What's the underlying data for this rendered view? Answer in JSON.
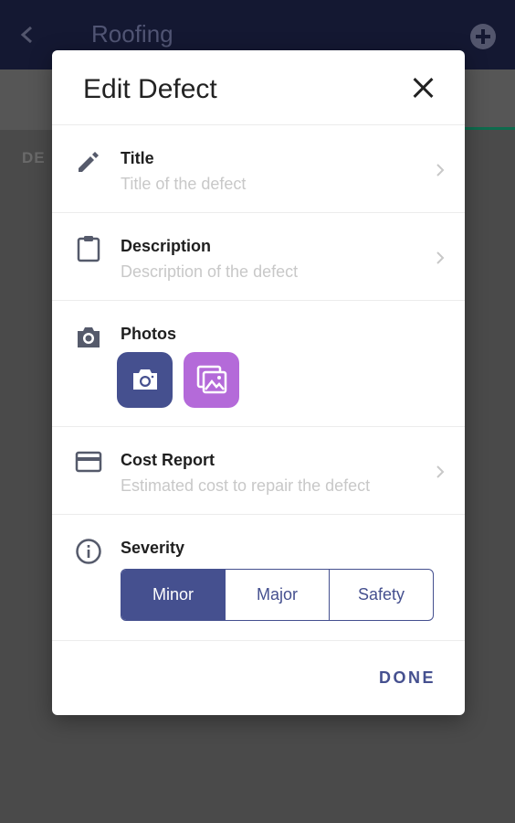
{
  "app": {
    "title": "Roofing",
    "section_label": "DE"
  },
  "dialog": {
    "title": "Edit Defect",
    "fields": {
      "title": {
        "label": "Title",
        "placeholder": "Title of the defect"
      },
      "description": {
        "label": "Description",
        "placeholder": "Description of the defect"
      },
      "photos": {
        "label": "Photos"
      },
      "cost": {
        "label": "Cost Report",
        "placeholder": "Estimated cost to repair the defect"
      },
      "severity": {
        "label": "Severity",
        "options": [
          "Minor",
          "Major",
          "Safety"
        ],
        "selected": "Minor"
      }
    },
    "done_label": "DONE"
  },
  "colors": {
    "accent": "#45508f",
    "gallery": "#b46ad9",
    "appbar": "#141832"
  }
}
